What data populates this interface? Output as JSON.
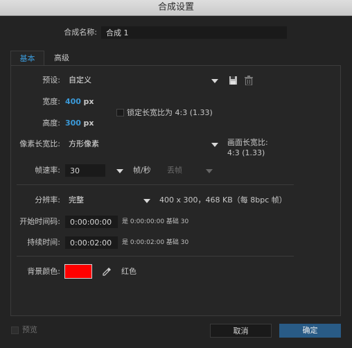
{
  "window": {
    "title": "合成设置"
  },
  "comp": {
    "name_label": "合成名称:",
    "name_value": "合成 1"
  },
  "tabs": [
    {
      "label": "基本"
    },
    {
      "label": "高级"
    }
  ],
  "preset": {
    "label": "预设:",
    "value": "自定义"
  },
  "width": {
    "label": "宽度:",
    "value": "400",
    "unit": "px"
  },
  "height": {
    "label": "高度:",
    "value": "300",
    "unit": "px"
  },
  "lock_aspect": {
    "label": "锁定长宽比为 4:3 (1.33)",
    "checked": false
  },
  "pixel_aspect": {
    "label": "像素长宽比:",
    "value": "方形像素"
  },
  "frame_aspect": {
    "label": "画面长宽比:",
    "value": "4:3 (1.33)"
  },
  "frame_rate": {
    "label": "帧速率:",
    "value": "30",
    "unit": "帧/秒",
    "drop_frame": "丢帧"
  },
  "resolution": {
    "label": "分辨率:",
    "value": "完整",
    "info": "400 x 300，468 KB（每 8bpc 帧）"
  },
  "start_timecode": {
    "label": "开始时间码:",
    "value": "0:00:00:00",
    "info": "是 0:00:00:00 基础 30"
  },
  "duration": {
    "label": "持续时间:",
    "value": "0:00:02:00",
    "info": "是 0:00:02:00 基础 30"
  },
  "background": {
    "label": "背景颜色:",
    "color": "#ff0000",
    "color_name": "红色"
  },
  "footer": {
    "preview_label": "预览",
    "cancel_label": "取消",
    "ok_label": "确定"
  },
  "colors": {
    "accent": "#3b9ad9",
    "ok_button": "#295b86"
  }
}
